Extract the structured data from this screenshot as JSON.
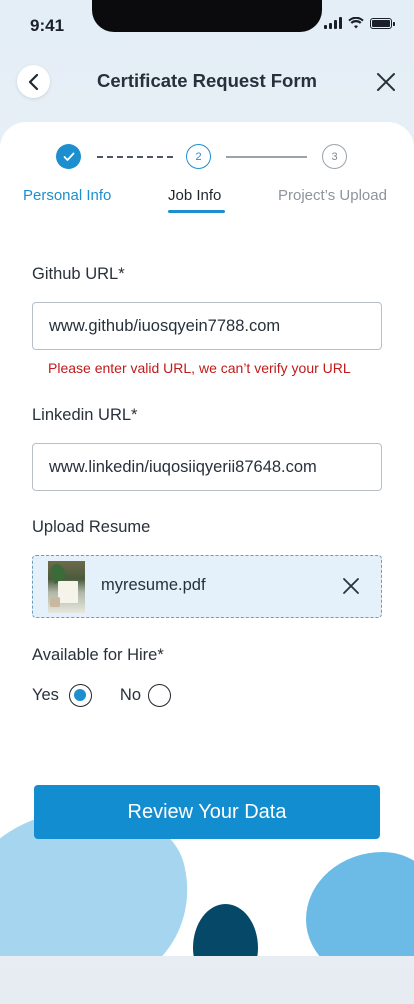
{
  "status_bar": {
    "time": "9:41"
  },
  "header": {
    "title": "Certificate Request Form"
  },
  "stepper": {
    "steps": [
      {
        "number": "",
        "label": "Personal Info",
        "state": "completed"
      },
      {
        "number": "2",
        "label": "Job Info",
        "state": "active"
      },
      {
        "number": "3",
        "label": "Project’s Upload",
        "state": "upcoming"
      }
    ]
  },
  "form": {
    "github": {
      "label": "Github URL*",
      "value": "www.github/iuosqyein7788.com",
      "error": "Please enter valid URL, we can’t verify your URL"
    },
    "linkedin": {
      "label": "Linkedin URL*",
      "value": "www.linkedin/iuqosiiqyerii87648.com"
    },
    "resume": {
      "label": "Upload Resume",
      "file_name": "myresume.pdf"
    },
    "hire": {
      "label": "Available for Hire*",
      "options": [
        {
          "label": "Yes",
          "selected": true
        },
        {
          "label": "No",
          "selected": false
        }
      ]
    }
  },
  "actions": {
    "review_label": "Review Your Data"
  },
  "colors": {
    "accent": "#1d8fcf",
    "error": "#c01a1a",
    "button": "#128dcf",
    "upload_bg": "#e4f1fa"
  }
}
